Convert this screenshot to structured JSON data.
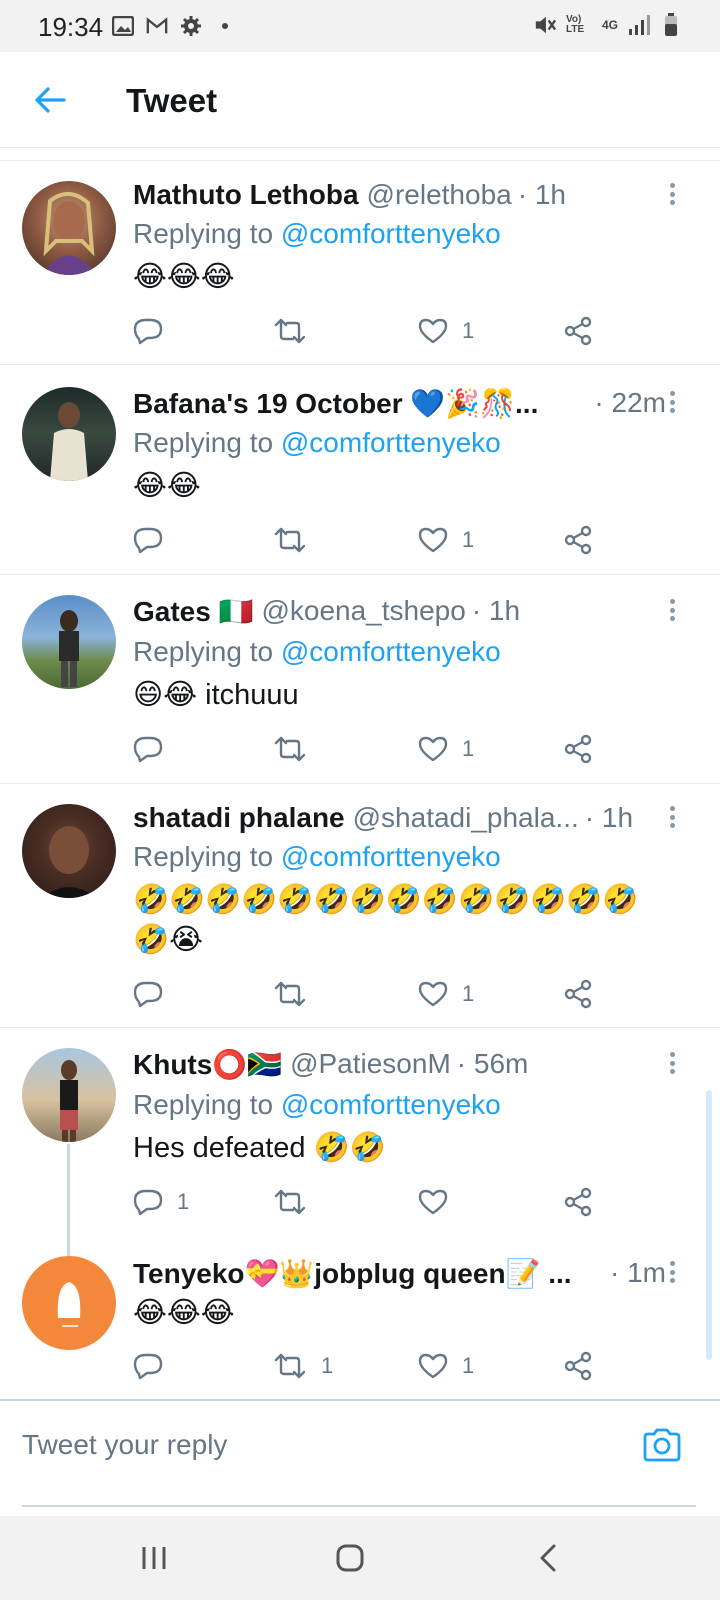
{
  "status_bar": {
    "time": "19:34",
    "left_icons": [
      "image-icon",
      "gmail-icon",
      "settings-icon",
      "dot-icon"
    ],
    "right_icons": [
      "mute-icon",
      "volte-icon",
      "4g-icon",
      "signal-icon",
      "battery-icon"
    ],
    "volte_label": "Vo) LTE",
    "network_label": "4G"
  },
  "header": {
    "title": "Tweet"
  },
  "tweets": [
    {
      "name": "Mathuto  Lethoba",
      "handle": "@relethoba",
      "time": "· 1h",
      "replying_prefix": "Replying to ",
      "replying_to": "@comforttenyeko",
      "text": "😂😂😂",
      "reply_count": "",
      "retweet_count": "",
      "like_count": "1"
    },
    {
      "name": "Bafana's 19 October 💙🎉🎊...",
      "handle": "",
      "time": "· 22m",
      "replying_prefix": "Replying to ",
      "replying_to": "@comforttenyeko",
      "text": "😂😂",
      "reply_count": "",
      "retweet_count": "",
      "like_count": "1"
    },
    {
      "name": "Gates 🇮🇹",
      "handle": "@koena_tshepo",
      "time": "· 1h",
      "replying_prefix": "Replying to ",
      "replying_to": "@comforttenyeko",
      "text": "😄😂 itchuuu",
      "reply_count": "",
      "retweet_count": "",
      "like_count": "1"
    },
    {
      "name": "shatadi phalane",
      "handle": "@shatadi_phala...",
      "time": "· 1h",
      "replying_prefix": "Replying to ",
      "replying_to": "@comforttenyeko",
      "text": "🤣🤣🤣🤣🤣🤣🤣🤣🤣🤣🤣🤣🤣🤣🤣😭",
      "reply_count": "",
      "retweet_count": "",
      "like_count": "1"
    },
    {
      "name": "Khuts⭕🇿🇦",
      "handle": "@PatiesonM",
      "time": "· 56m",
      "replying_prefix": "Replying to ",
      "replying_to": "@comforttenyeko",
      "text": "Hes defeated 🤣🤣",
      "reply_count": "1",
      "retweet_count": "",
      "like_count": ""
    },
    {
      "name": "Tenyeko💝👑jobplug queen📝 ...",
      "handle": "",
      "time": "· 1m",
      "replying_prefix": "",
      "replying_to": "",
      "text": "😂😂😂",
      "reply_count": "",
      "retweet_count": "1",
      "like_count": "1"
    }
  ],
  "composer": {
    "placeholder": "Tweet your reply"
  },
  "nav": [
    "recents-button",
    "home-button",
    "back-button"
  ]
}
